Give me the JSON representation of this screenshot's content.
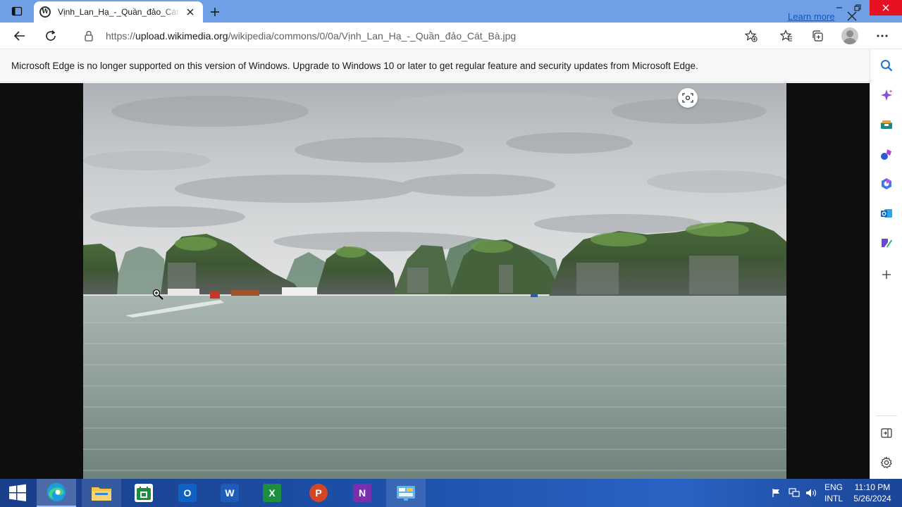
{
  "browser": {
    "tab": {
      "title": "Vịnh_Lan_Hạ_-_Quần_đảo_Cát_Bà.jpg",
      "favicon": "wikimedia-icon"
    },
    "url": {
      "prefix": "https://",
      "domain": "upload.wikimedia.org",
      "path": "/wikipedia/commons/0/0a/Vịnh_Lan_Hạ_-_Quần_đảo_Cát_Bà.jpg"
    },
    "window_controls": [
      "minimize-icon",
      "restore-icon",
      "close-icon"
    ],
    "toolbar_icons": [
      "back-arrow-icon",
      "refresh-icon",
      "lock-icon",
      "add-favorite-icon",
      "favorites-icon",
      "collections-icon",
      "profile-avatar",
      "more-options-icon"
    ]
  },
  "infobar": {
    "message": "Microsoft Edge is no longer supported on this version of Windows. Upgrade to Windows 10 or later to get regular feature and security updates from Microsoft Edge.",
    "link": "Learn more"
  },
  "sidebar": {
    "items": [
      "search-icon",
      "copilot-icon",
      "shopping-icon",
      "games-icon",
      "office-icon",
      "outlook-icon",
      "drop-icon",
      "add-icon",
      "hide-sidebar-icon",
      "settings-icon"
    ]
  },
  "taskbar": {
    "apps": [
      "edge-icon",
      "file-explorer-icon",
      "excel-store-icon",
      "outlook-icon",
      "word-icon",
      "excel-icon",
      "powerpoint-icon",
      "onenote-icon",
      "control-panel-icon"
    ],
    "language_line1": "ENG",
    "language_line2": "INTL",
    "time": "11:10 PM",
    "date": "5/26/2024"
  },
  "colors": {
    "titlebar": "#6fa0e6",
    "close_button": "#e81123",
    "link": "#0a58ca",
    "taskbar": "#1d4fa8"
  }
}
